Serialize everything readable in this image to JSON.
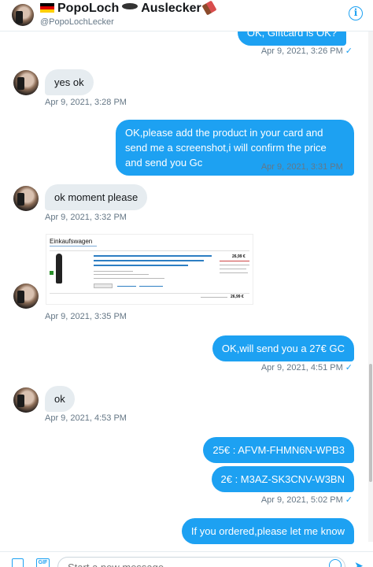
{
  "header": {
    "name_part1": "PopoLoch",
    "name_part2": "Auslecker",
    "handle": "@PopoLochLecker",
    "info_icon": "i"
  },
  "messages": [
    {
      "dir": "out",
      "text": "OK, Giftcard is OK?",
      "time": "Apr 9, 2021, 3:26 PM"
    },
    {
      "dir": "in",
      "text": "yes ok",
      "time": "Apr 9, 2021, 3:28 PM"
    },
    {
      "dir": "out",
      "text": "OK,please add the product in your card and send me a screenshot,i will confirm the price and send you Gc",
      "time": "Apr 9, 2021, 3:31 PM"
    },
    {
      "dir": "in",
      "text": "ok moment please",
      "time": "Apr 9, 2021, 3:32 PM"
    },
    {
      "dir": "in",
      "type": "image",
      "time": "Apr 9, 2021, 3:35 PM"
    },
    {
      "dir": "out",
      "text": "OK,will send you a 27€ GC",
      "time": "Apr 9, 2021, 4:51 PM"
    },
    {
      "dir": "in",
      "text": "ok",
      "time": "Apr 9, 2021, 4:53 PM"
    },
    {
      "dir": "out",
      "text": "25€ : AFVM-FHMN6N-WPB3"
    },
    {
      "dir": "out",
      "text": "2€ : M3AZ-SK3CNV-W3BN",
      "time": "Apr 9, 2021, 5:02 PM"
    },
    {
      "dir": "out",
      "text": "If you ordered,please let me know"
    }
  ],
  "screenshot_image": {
    "heading": "Einkaufswagen",
    "price": "26,99 €",
    "subtotal_price": "26,99 €"
  },
  "composer": {
    "placeholder": "Start a new message",
    "gif_label": "GIF"
  },
  "colors": {
    "accent": "#1da1f2",
    "incoming_bubble": "#e6ecf0",
    "timestamp": "#657786"
  },
  "icons": [
    "info-icon",
    "image-icon",
    "gif-icon",
    "emoji-icon",
    "send-icon",
    "read-check-icon"
  ]
}
